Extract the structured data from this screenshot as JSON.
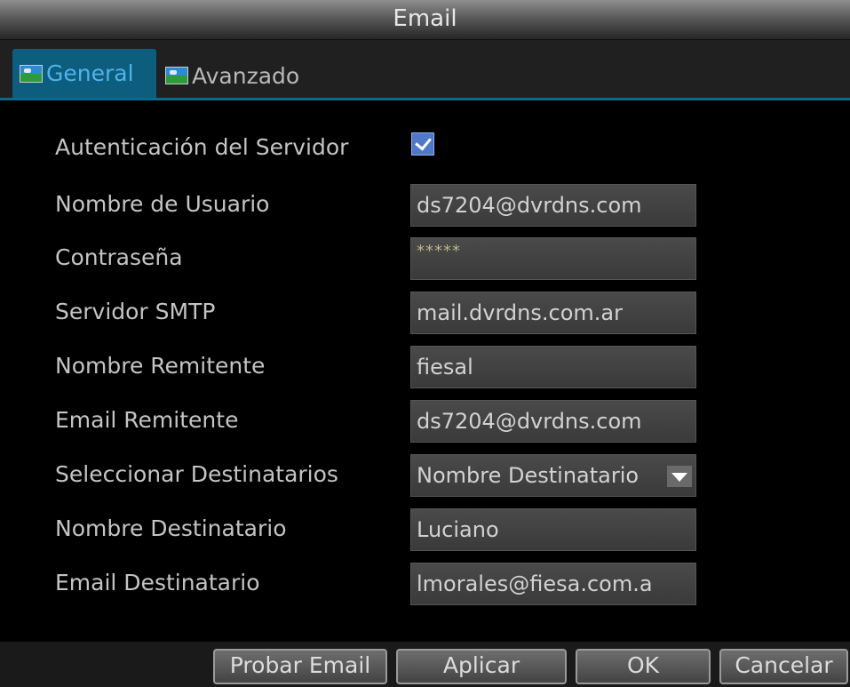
{
  "window": {
    "title": "Email"
  },
  "tabs": [
    {
      "label": "General",
      "icon": "image-icon",
      "active": true
    },
    {
      "label": "Avanzado",
      "icon": "image-icon",
      "active": false
    }
  ],
  "form": {
    "server_auth": {
      "label": "Autenticación del Servidor",
      "checked": true
    },
    "username": {
      "label": "Nombre de Usuario",
      "value": "ds7204@dvrdns.com"
    },
    "password": {
      "label": "Contraseña",
      "value": "*****"
    },
    "smtp_server": {
      "label": "Servidor SMTP",
      "value": "mail.dvrdns.com.ar"
    },
    "sender_name": {
      "label": "Nombre Remitente",
      "value": "fiesal"
    },
    "sender_email": {
      "label": "Email Remitente",
      "value": "ds7204@dvrdns.com"
    },
    "select_recipients": {
      "label": "Seleccionar Destinatarios",
      "value": "Nombre Destinatario"
    },
    "recipient_name": {
      "label": "Nombre Destinatario",
      "value": "Luciano"
    },
    "recipient_email": {
      "label": "Email Destinatario",
      "value": "lmorales@fiesa.com.a"
    }
  },
  "buttons": {
    "test_email": "Probar Email",
    "apply": "Aplicar",
    "ok": "OK",
    "cancel": "Cancelar"
  },
  "colors": {
    "active_tab_bg": "#0d5d7e",
    "active_tab_text": "#4fb3ea",
    "checkbox_blue": "#4f79c8"
  }
}
